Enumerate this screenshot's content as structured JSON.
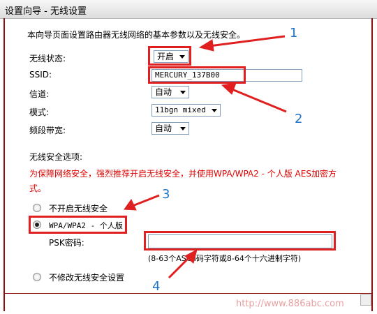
{
  "title": "设置向导 - 无线设置",
  "intro": "本向导页面设置路由器无线网络的基本参数以及无线安全。",
  "fields": {
    "wireless_status_label": "无线状态:",
    "wireless_status_value": "开启",
    "ssid_label": "SSID:",
    "ssid_value": "MERCURY_137B00",
    "channel_label": "信道:",
    "channel_value": "自动",
    "mode_label": "模式:",
    "mode_value": "11bgn mixed",
    "bandwidth_label": "频段带宽:",
    "bandwidth_value": "自动"
  },
  "security": {
    "heading": "无线安全选项:",
    "warning_line1": "为保障网络安全，强烈推荐开启无线安全，并使用WPA/WPA2 - 个人版 AES加密方",
    "warning_line2": "式。",
    "opt_disable": "不开启无线安全",
    "opt_wpa": "WPA/WPA2 - 个人版",
    "psk_label": "PSK密码:",
    "psk_value": "",
    "psk_hint": "(8-63个ASCII码字符或8-64个十六进制字符)",
    "opt_keep": "不修改无线安全设置",
    "selected": "WPA/WPA2 - 个人版"
  },
  "annotations": [
    "1",
    "2",
    "3",
    "4"
  ],
  "watermark": "http://www.886abc.com",
  "colors": {
    "annotation_red": "#e02020",
    "annotation_blue": "#1e73c8",
    "frame": "#8b1010",
    "warning": "#e00000"
  }
}
